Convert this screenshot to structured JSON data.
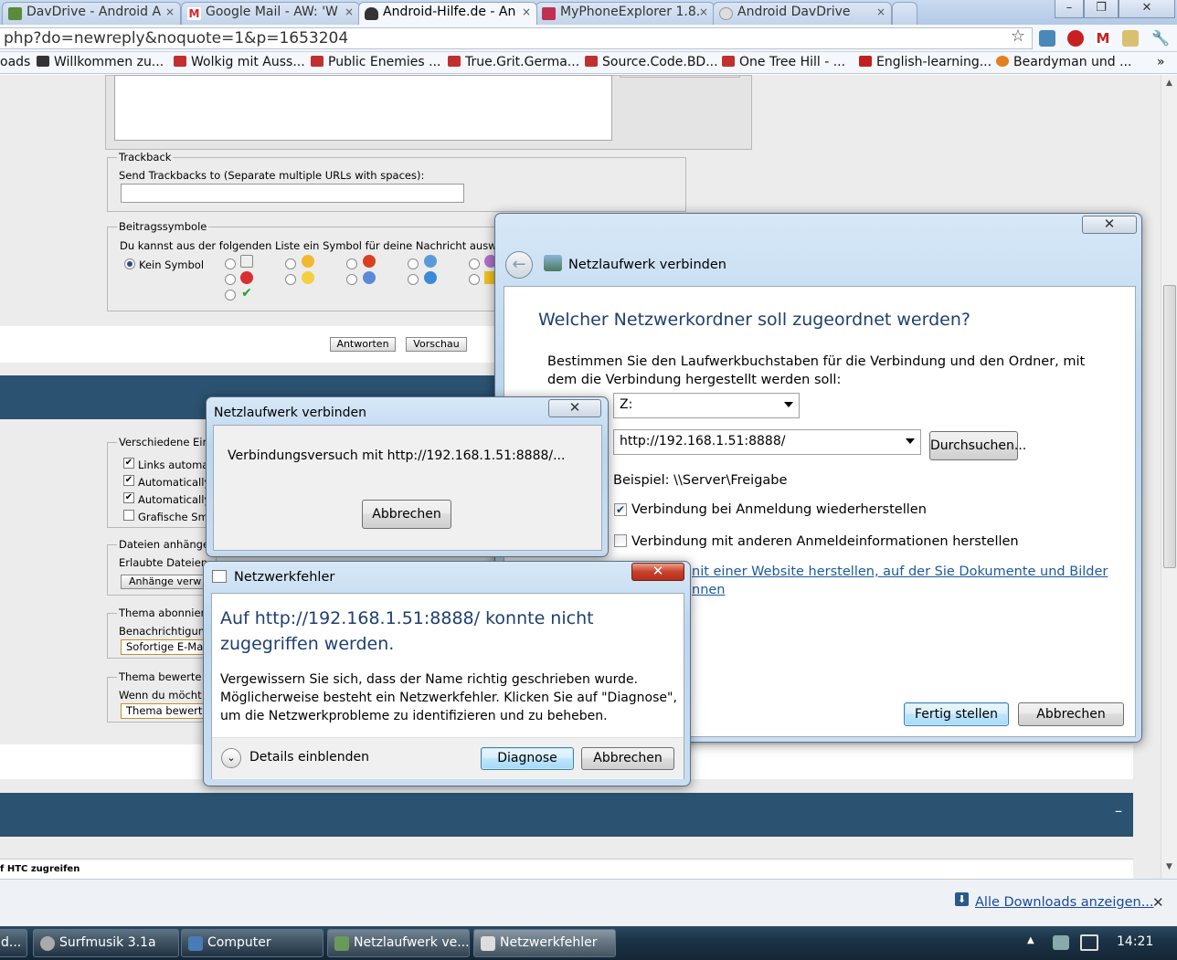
{
  "browser": {
    "tabs": [
      {
        "label": "DavDrive - Android A",
        "close": "×",
        "icon_color": "#5a8a3a"
      },
      {
        "label": "Google Mail - AW: 'W",
        "close": "×",
        "icon_color": "#d22"
      },
      {
        "label": "Android-Hilfe.de - An",
        "close": "×",
        "icon_color": "#333"
      },
      {
        "label": "MyPhoneExplorer 1.8.",
        "close": "×",
        "icon_color": "#c03050"
      },
      {
        "label": "Android DavDrive",
        "close": "×",
        "icon_color": "#999"
      }
    ],
    "url": "php?do=newreply&noquote=1&p=1653204",
    "bookmarks": [
      {
        "label": "oads",
        "color": ""
      },
      {
        "label": "Willkommen zu...",
        "color": "#333"
      },
      {
        "label": "Wolkig mit Auss...",
        "color": "#c03030"
      },
      {
        "label": "Public Enemies ...",
        "color": "#c03030"
      },
      {
        "label": "True.Grit.Germa...",
        "color": "#c03030"
      },
      {
        "label": "Source.Code.BD...",
        "color": "#c03030"
      },
      {
        "label": "One Tree Hill - ...",
        "color": "#c03030"
      },
      {
        "label": "English-learning...",
        "color": "#c02020"
      },
      {
        "label": "Beardyman und ...",
        "color": "#e08020"
      }
    ],
    "bookmarks_more": "»"
  },
  "forum": {
    "trackback": {
      "legend": "Trackback",
      "label": "Send Trackbacks to (Separate multiple URLs with spaces):",
      "value": ""
    },
    "symbols": {
      "legend": "Beitragssymbole",
      "description": "Du kannst aus der folgenden Liste ein Symbol für deine Nachricht auswä",
      "none_label": "Kein Symbol"
    },
    "reply_button": "Antworten",
    "preview_button": "Vorschau",
    "misc": {
      "legend": "Verschiedene Ein",
      "options": [
        "Links automa",
        "Automatically",
        "Automatically",
        "Grafische Sm"
      ],
      "checked": [
        true,
        true,
        true,
        false
      ]
    },
    "attachments": {
      "legend": "Dateien anhänge",
      "label": "Erlaubte Dateien",
      "button": "Anhänge verw"
    },
    "subscribe": {
      "legend": "Thema abonnier",
      "label": "Benachrichtigun",
      "select": "Sofortige E-Ma"
    },
    "rate": {
      "legend": "Thema bewerte",
      "label": "Wenn du möcht",
      "select": "Thema bewerte"
    },
    "bottom_text": "f HTC zugreifen",
    "collapse": "–"
  },
  "downloads": {
    "link": "Alle Downloads anzeigen...",
    "close": "✕"
  },
  "taskbar": {
    "items": [
      {
        "label": "d...",
        "color": "#888"
      },
      {
        "label": "Surfmusik 3.1a",
        "color": "#aaa"
      },
      {
        "label": "Computer",
        "color": "#4a7ab8"
      },
      {
        "label": "Netzlaufwerk ve...",
        "color": "#6a9a5a"
      },
      {
        "label": "Netzwerkfehler",
        "color": "#ddd"
      }
    ],
    "time": "14:21",
    "tray_arrow": "▲"
  },
  "map_drive_dialog": {
    "title": "Netzlaufwerk verbinden",
    "heading": "Welcher Netzwerkordner soll zugeordnet werden?",
    "description": "Bestimmen Sie den Laufwerkbuchstaben für die Verbindung und den Ordner, mit dem die Verbindung hergestellt werden soll:",
    "drive_value": "Z:",
    "folder_value": "http://192.168.1.51:8888/",
    "browse_button": "Durchsuchen...",
    "example": "Beispiel: \\\\Server\\Freigabe",
    "reconnect_label": "Verbindung bei Anmeldung wiederherstellen",
    "reconnect_checked": true,
    "other_creds_label": "Verbindung mit anderen Anmeldeinformationen herstellen",
    "other_creds_checked": false,
    "link_line1": "nit einer Website herstellen, auf der Sie Dokumente und Bilder",
    "link_line2": "nnen",
    "finish_button": "Fertig stellen",
    "cancel_button": "Abbrechen",
    "close": "✕"
  },
  "connecting_dialog": {
    "title": "Netzlaufwerk verbinden",
    "message": "Verbindungsversuch mit http://192.168.1.51:8888/...",
    "cancel_button": "Abbrechen",
    "close": "✕"
  },
  "error_dialog": {
    "title": "Netzwerkfehler",
    "heading": "Auf http://192.168.1.51:8888/ konnte nicht zugegriffen werden.",
    "body": "Vergewissern Sie sich, dass der Name richtig geschrieben wurde. Möglicherweise besteht ein Netzwerkfehler. Klicken Sie auf \"Diagnose\", um die Netzwerkprobleme zu identifizieren und zu beheben.",
    "details_label": "Details einblenden",
    "diagnose_button": "Diagnose",
    "cancel_button": "Abbrechen",
    "close": "✕"
  }
}
